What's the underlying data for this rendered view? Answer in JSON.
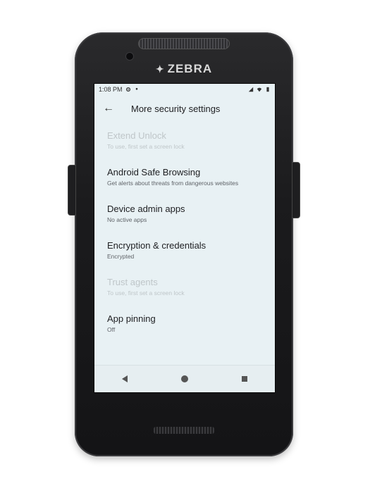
{
  "device": {
    "brand": "ZEBRA",
    "brand_icon": "zebra-logo-icon"
  },
  "statusbar": {
    "time": "1:08 PM",
    "icons_left": [
      "settings-gear-icon",
      "notification-dot-icon"
    ],
    "icons_right": [
      "signal-icon",
      "wifi-icon",
      "battery-icon"
    ]
  },
  "appbar": {
    "back_icon": "arrow-left-icon",
    "title": "More security settings"
  },
  "settings": [
    {
      "title": "Extend Unlock",
      "subtitle": "To use, first set a screen lock",
      "enabled": false
    },
    {
      "title": "Android Safe Browsing",
      "subtitle": "Get alerts about threats from dangerous websites",
      "enabled": true
    },
    {
      "title": "Device admin apps",
      "subtitle": "No active apps",
      "enabled": true
    },
    {
      "title": "Encryption & credentials",
      "subtitle": "Encrypted",
      "enabled": true
    },
    {
      "title": "Trust agents",
      "subtitle": "To use, first set a screen lock",
      "enabled": false
    },
    {
      "title": "App pinning",
      "subtitle": "Off",
      "enabled": true
    }
  ],
  "navbar": {
    "back": "nav-back-triangle-icon",
    "home": "nav-home-circle-icon",
    "recents": "nav-recents-square-icon"
  },
  "colors": {
    "screen_bg": "#e8f1f4",
    "disabled_text": "#bfc6c9",
    "device_body": "#1b1b1d"
  }
}
